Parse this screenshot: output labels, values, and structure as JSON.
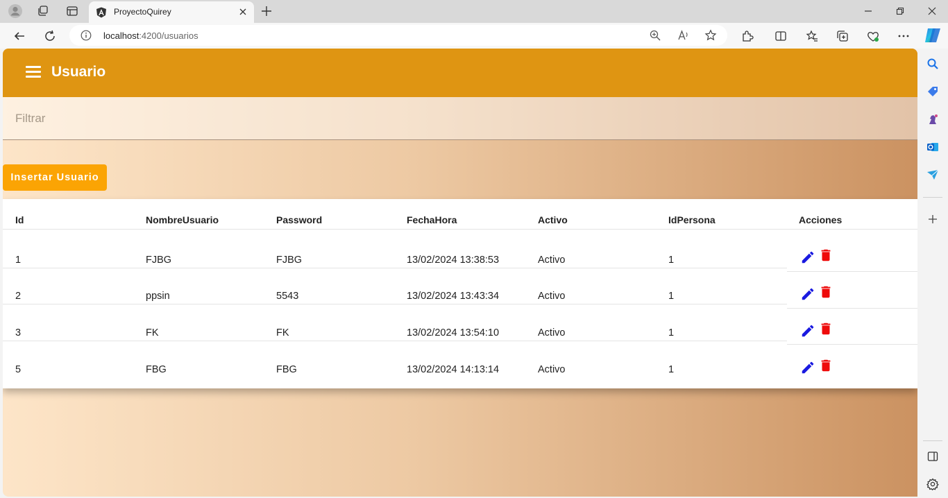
{
  "browser": {
    "tab_title": "ProyectoQuirey",
    "url_host": "localhost",
    "url_path": ":4200/usuarios"
  },
  "app": {
    "title": "Usuario",
    "filter_placeholder": "Filtrar",
    "insert_button": "Insertar Usuario",
    "colors": {
      "appbar": "#df9512",
      "insert_button": "#fba404",
      "edit_icon": "#1a1ae0",
      "delete_icon": "#ee0b0b"
    }
  },
  "table": {
    "columns": [
      "Id",
      "NombreUsuario",
      "Password",
      "FechaHora",
      "Activo",
      "IdPersona",
      "Acciones"
    ],
    "rows": [
      {
        "id": "1",
        "nombre": "FJBG",
        "password": "FJBG",
        "fecha": "13/02/2024 13:38:53",
        "activo": "Activo",
        "idpersona": "1"
      },
      {
        "id": "2",
        "nombre": "ppsin",
        "password": "5543",
        "fecha": "13/02/2024 13:43:34",
        "activo": "Activo",
        "idpersona": "1"
      },
      {
        "id": "3",
        "nombre": "FK",
        "password": "FK",
        "fecha": "13/02/2024 13:54:10",
        "activo": "Activo",
        "idpersona": "1"
      },
      {
        "id": "5",
        "nombre": "FBG",
        "password": "FBG",
        "fecha": "13/02/2024 14:13:14",
        "activo": "Activo",
        "idpersona": "1"
      }
    ]
  }
}
